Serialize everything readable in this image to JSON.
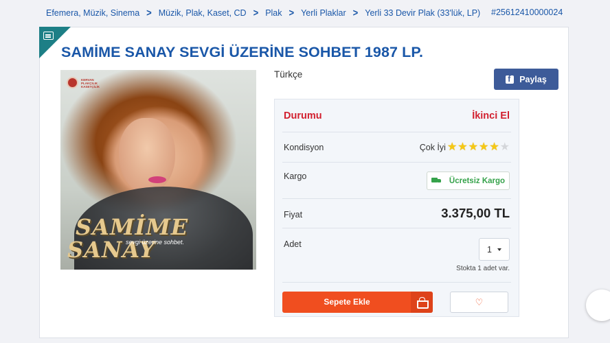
{
  "breadcrumb": {
    "items": [
      "Efemera, Müzik, Sinema",
      "Müzik, Plak, Kaset, CD",
      "Plak",
      "Yerli Plaklar",
      "Yerli 33 Devir Plak (33'lük, LP)"
    ],
    "separator": ">"
  },
  "product_id": "#25612410000024",
  "product": {
    "title": "SAMİME SANAY SEVGİ ÜZERİNE SOHBET 1987 LP.",
    "language": "Türkçe",
    "cover_art": {
      "logo_text": "KERVAN PLAKÇILIK KASETÇİLİK",
      "artist_line1": "SAMİME",
      "artist_line2": "SANAY",
      "album_subtitle": "sevgi üzerine sohbet."
    }
  },
  "share_label": "Paylaş",
  "details": {
    "condition_label": "Durumu",
    "condition_value": "İkinci El",
    "kondisyon_label": "Kondisyon",
    "kondisyon_value": "Çok İyi",
    "rating": {
      "value": 5,
      "max": 6
    },
    "cargo_label": "Kargo",
    "cargo_value": "Ücretsiz Kargo",
    "price_label": "Fiyat",
    "price_value": "3.375,00 TL",
    "quantity_label": "Adet",
    "quantity_value": "1",
    "stock_text": "Stokta 1 adet var."
  },
  "actions": {
    "add_to_cart": "Sepete Ekle",
    "favorite_icon": "heart-icon",
    "cart_icon": "basket-icon"
  },
  "colors": {
    "link_blue": "#1a57a8",
    "condition_red": "#d2202f",
    "cta_orange": "#f04e1f",
    "cargo_green": "#35a24a",
    "facebook_blue": "#3d5b99",
    "corner_teal": "#1d7f86"
  }
}
